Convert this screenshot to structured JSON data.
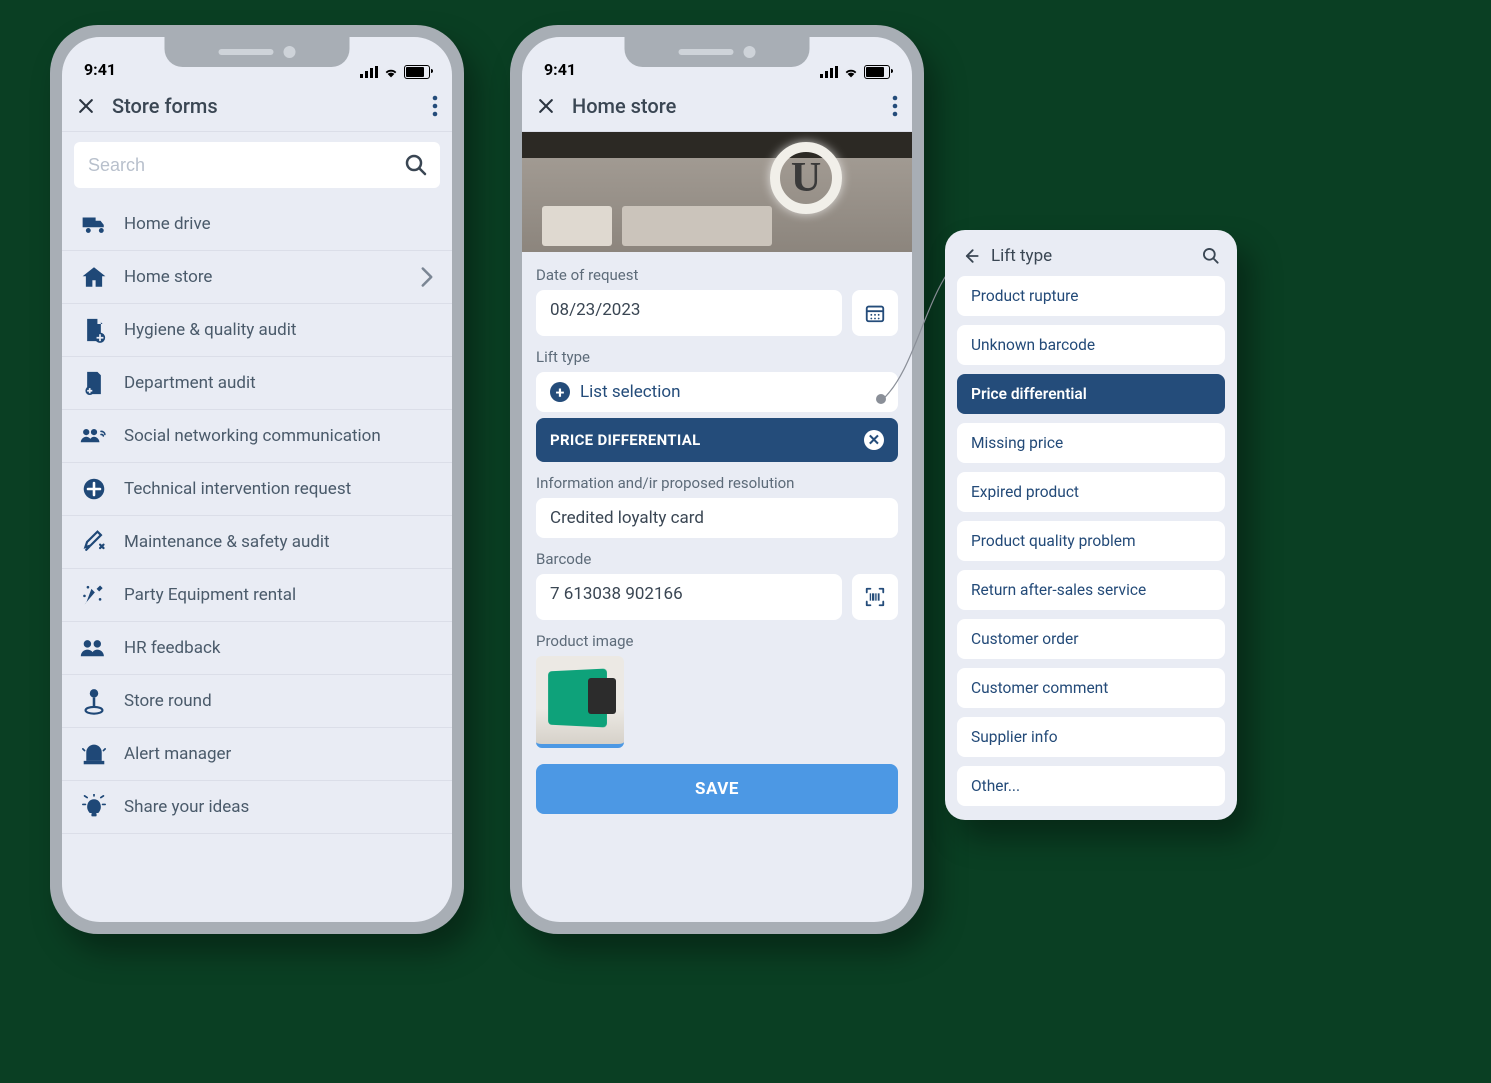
{
  "status_time": "9:41",
  "phone1": {
    "title": "Store forms",
    "search_placeholder": "Search",
    "items": [
      {
        "label": "Home drive"
      },
      {
        "label": "Home store",
        "chevron": true
      },
      {
        "label": "Hygiene & quality audit"
      },
      {
        "label": "Department audit"
      },
      {
        "label": "Social networking communication"
      },
      {
        "label": "Technical intervention request"
      },
      {
        "label": "Maintenance & safety audit"
      },
      {
        "label": "Party Equipment rental"
      },
      {
        "label": "HR feedback"
      },
      {
        "label": "Store round"
      },
      {
        "label": "Alert manager"
      },
      {
        "label": "Share your ideas"
      }
    ]
  },
  "phone2": {
    "title": "Home store",
    "hero_brand": "U",
    "date_label": "Date of request",
    "date_value": "08/23/2023",
    "lift_label": "Lift type",
    "lift_placeholder": "List selection",
    "lift_selected": "PRICE DIFFERENTIAL",
    "info_label": "Information and/ir proposed resolution",
    "info_value": "Credited loyalty card",
    "barcode_label": "Barcode",
    "barcode_value": "7 613038 902166",
    "image_label": "Product image",
    "save": "SAVE"
  },
  "popover": {
    "title": "Lift type",
    "options": [
      {
        "label": "Product rupture"
      },
      {
        "label": "Unknown barcode"
      },
      {
        "label": "Price differential",
        "selected": true
      },
      {
        "label": "Missing price"
      },
      {
        "label": "Expired product"
      },
      {
        "label": "Product quality problem"
      },
      {
        "label": "Return after-sales service"
      },
      {
        "label": "Customer order"
      },
      {
        "label": "Customer comment"
      },
      {
        "label": "Supplier info"
      },
      {
        "label": "Other..."
      }
    ]
  }
}
